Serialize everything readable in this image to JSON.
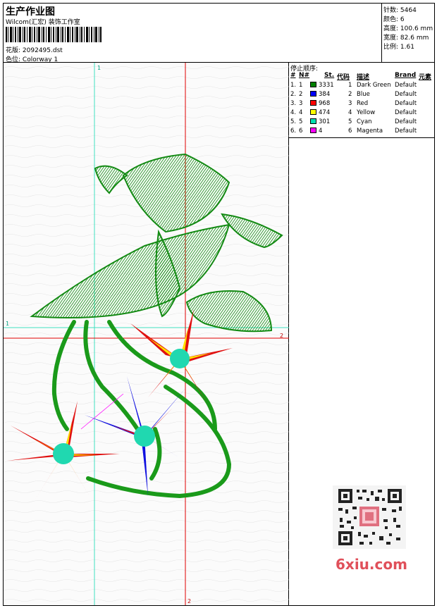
{
  "header": {
    "title": "生产作业图",
    "subtitle": "Wilcom(汇宏) 装饰工作室",
    "design_label": "花版:",
    "design_value": "2092495.dst",
    "colorway_label": "色位:",
    "colorway_value": "Colorway 1"
  },
  "stats": {
    "stitches_label": "针数:",
    "stitches_value": "5464",
    "colors_label": "颜色:",
    "colors_value": "6",
    "height_label": "高度:",
    "height_value": "100.6 mm",
    "width_label": "宽度:",
    "width_value": "82.6 mm",
    "ratio_label": "比例:",
    "ratio_value": "1.61"
  },
  "stop_sequence": {
    "title": "停止顺序:",
    "columns": [
      "#",
      "N#",
      "St.",
      "代码",
      "描述",
      "Brand",
      "元素"
    ],
    "rows": [
      {
        "idx": "1.",
        "n": "1",
        "st": "3331",
        "code": "1",
        "desc": "Dark Green",
        "brand": "Default",
        "color": "#008000"
      },
      {
        "idx": "2.",
        "n": "2",
        "st": "384",
        "code": "2",
        "desc": "Blue",
        "brand": "Default",
        "color": "#0000ff"
      },
      {
        "idx": "3.",
        "n": "3",
        "st": "968",
        "code": "3",
        "desc": "Red",
        "brand": "Default",
        "color": "#ff0000"
      },
      {
        "idx": "4.",
        "n": "4",
        "st": "474",
        "code": "4",
        "desc": "Yellow",
        "brand": "Default",
        "color": "#ffff00"
      },
      {
        "idx": "5.",
        "n": "5",
        "st": "301",
        "code": "5",
        "desc": "Cyan",
        "brand": "Default",
        "color": "#00e0b0"
      },
      {
        "idx": "6.",
        "n": "6",
        "st": "4",
        "code": "6",
        "desc": "Magenta",
        "brand": "Default",
        "color": "#ff00ff"
      }
    ]
  },
  "axes": {
    "v1_label": "1",
    "h1_label": "1",
    "v2_label": "2",
    "h2_label": "2",
    "guide_color_1": "#40e0c0",
    "guide_color_2": "#e00000"
  },
  "watermark": {
    "text": "6xiu.com",
    "color": "#e0505a"
  }
}
